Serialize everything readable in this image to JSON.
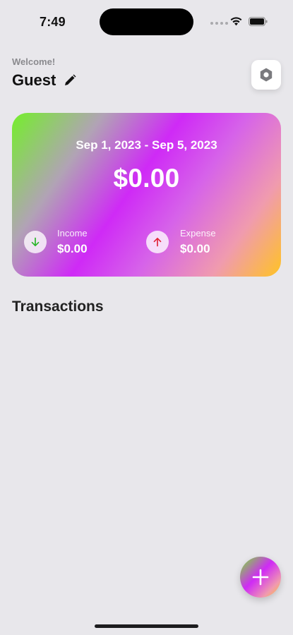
{
  "status_bar": {
    "time": "7:49"
  },
  "header": {
    "welcome": "Welcome!",
    "username": "Guest"
  },
  "card": {
    "date_range": "Sep 1, 2023 - Sep 5, 2023",
    "balance": "$0.00",
    "income": {
      "label": "Income",
      "value": "$0.00"
    },
    "expense": {
      "label": "Expense",
      "value": "$0.00"
    }
  },
  "transactions": {
    "title": "Transactions"
  },
  "icons": {
    "edit": "pencil-icon",
    "settings": "hexagon-settings-icon",
    "income": "arrow-down-icon",
    "expense": "arrow-up-icon",
    "add": "plus-icon"
  },
  "colors": {
    "background": "#e8e7eb",
    "income_arrow": "#2bb52b",
    "expense_arrow": "#e0243a",
    "gradient": [
      "#74ef2a",
      "#cf2af6",
      "#f09bae",
      "#ffc324"
    ]
  }
}
